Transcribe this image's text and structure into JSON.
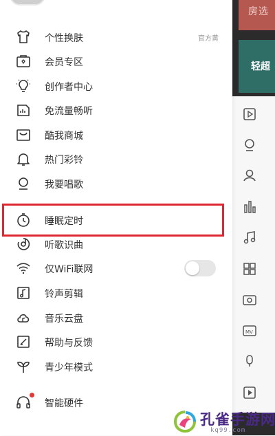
{
  "background_screen": {
    "banner_top_text": "房选",
    "banner_teal_text": "轻超"
  },
  "menu": {
    "items": [
      {
        "label": "个性换肤",
        "sub": "官方黄",
        "icon": "shirt-icon"
      },
      {
        "label": "会员专区",
        "icon": "vip-card-icon"
      },
      {
        "label": "创作者中心",
        "icon": "lightbulb-icon"
      },
      {
        "label": "免流量畅听",
        "icon": "sim-card-icon"
      },
      {
        "label": "酷我商城",
        "icon": "shop-icon"
      },
      {
        "label": "热门彩铃",
        "icon": "bell-icon"
      },
      {
        "label": "我要唱歌",
        "icon": "microphone-icon"
      },
      {
        "label": "睡眠定时",
        "icon": "timer-icon"
      },
      {
        "label": "听歌识曲",
        "icon": "music-recognize-icon"
      },
      {
        "label": "仅WiFi联网",
        "icon": "wifi-icon"
      },
      {
        "label": "铃声剪辑",
        "icon": "ringtone-edit-icon"
      },
      {
        "label": "音乐云盘",
        "icon": "cloud-icon"
      },
      {
        "label": "帮助与反馈",
        "icon": "feedback-icon"
      },
      {
        "label": "青少年模式",
        "icon": "sprout-icon"
      },
      {
        "label": "智能硬件",
        "icon": "headphones-icon"
      }
    ],
    "wifi_only_toggle": "off"
  },
  "watermark": {
    "title": "孔雀手游网",
    "url": "kq99.com"
  },
  "colors": {
    "highlight": "#e0262e",
    "watermark": "#4a2a86"
  }
}
